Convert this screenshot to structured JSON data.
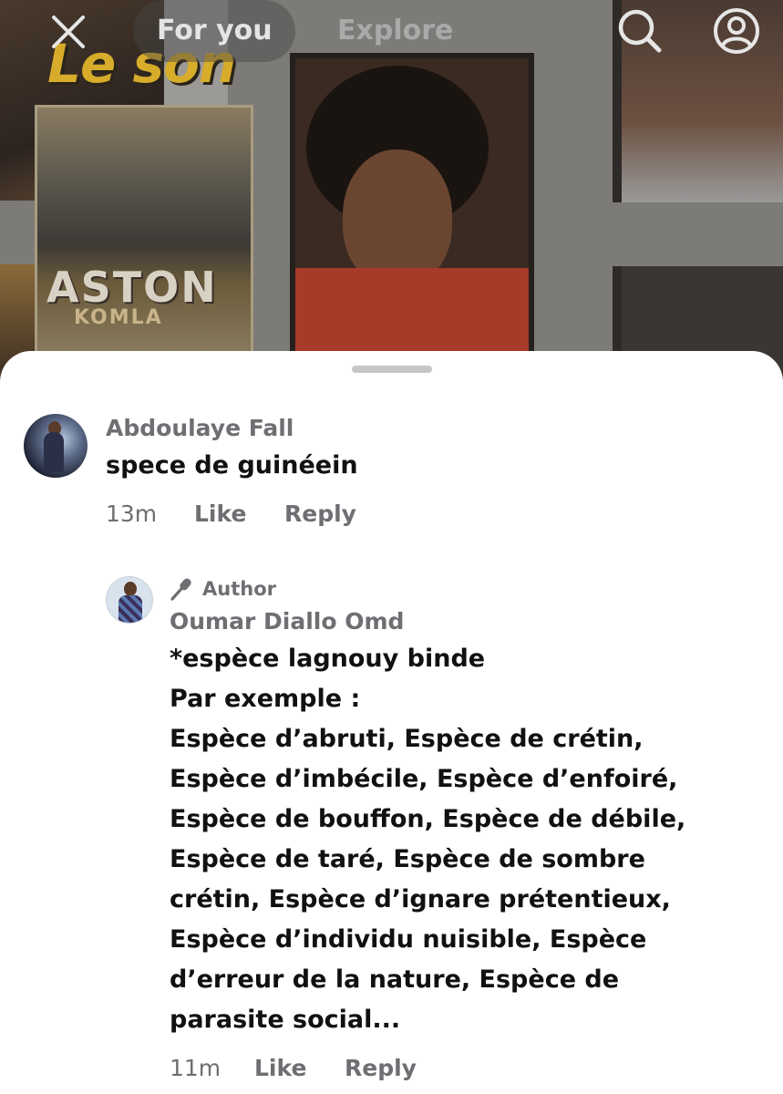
{
  "topnav": {
    "tabs": [
      {
        "label": "For you",
        "active": true
      },
      {
        "label": "Explore",
        "active": false
      }
    ],
    "icons": {
      "close": "close-icon",
      "search": "search-icon",
      "profile": "profile-icon"
    }
  },
  "background": {
    "overlay_text": "Le son",
    "poster_title": "ASTON",
    "poster_subtitle": "KOMLA"
  },
  "comments": [
    {
      "username": "Abdoulaye Fall",
      "text": "spece de guinéein",
      "time": "13m",
      "like_label": "Like",
      "reply_label": "Reply"
    },
    {
      "badge": "Author",
      "badge_icon": "microphone-icon",
      "username": "Oumar Diallo Omd",
      "text": "*espèce lagnouy binde\nPar exemple :\nEspèce d’abruti, Espèce de crétin,\nEspèce d’imbécile, Espèce d’enfoiré,\nEspèce de bouffon, Espèce de débile,\nEspèce de taré, Espèce de sombre\ncrétin, Espèce d’ignare prétentieux,\nEspèce d’individu nuisible, Espèce\nd’erreur de la nature, Espèce de\nparasite social...",
      "time": "11m",
      "like_label": "Like",
      "reply_label": "Reply"
    }
  ],
  "colors": {
    "sheet": "#ffffff",
    "secondary_text": "#6e6e73",
    "primary_text": "#111111",
    "grabber": "#c6c6c9"
  }
}
